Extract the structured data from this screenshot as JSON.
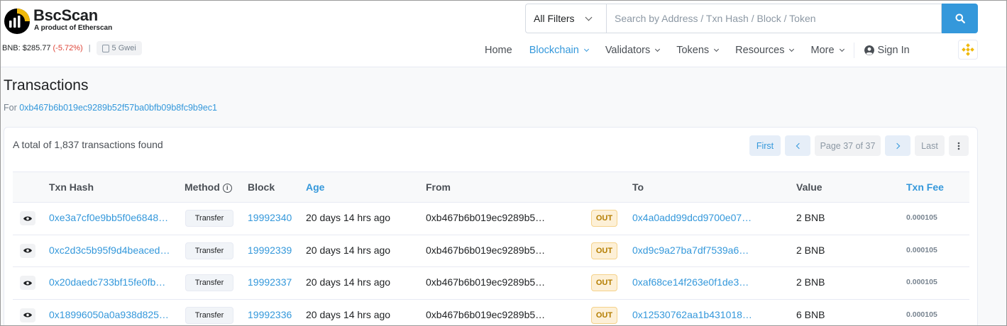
{
  "brand": {
    "name": "BscScan",
    "tagline": "A product of Etherscan"
  },
  "price": {
    "label": "BNB: $285.77",
    "change": "(-5.72%)",
    "separator": "|",
    "gas": "5 Gwei"
  },
  "search": {
    "filter_label": "All Filters",
    "placeholder": "Search by Address / Txn Hash / Block / Token"
  },
  "nav": {
    "items": [
      {
        "label": "Home"
      },
      {
        "label": "Blockchain"
      },
      {
        "label": "Validators"
      },
      {
        "label": "Tokens"
      },
      {
        "label": "Resources"
      },
      {
        "label": "More"
      }
    ],
    "signin": "Sign In"
  },
  "page": {
    "title": "Transactions",
    "for_prefix": "For",
    "address": "0xb467b6b019ec9289b52f57ba0bfb09b8fc9b9ec1"
  },
  "summary": {
    "total_text": "A total of 1,837 transactions found"
  },
  "pager": {
    "first": "First",
    "page_text": "Page 37 of 37",
    "last": "Last"
  },
  "table": {
    "headers": {
      "txn_hash": "Txn Hash",
      "method": "Method",
      "block": "Block",
      "age": "Age",
      "from": "From",
      "to": "To",
      "value": "Value",
      "txn_fee": "Txn Fee"
    },
    "rows": [
      {
        "hash": "0xe3a7cf0e9bb5f0e6848…",
        "method": "Transfer",
        "block": "19992340",
        "age": "20 days 14 hrs ago",
        "from": "0xb467b6b019ec9289b5…",
        "direction": "OUT",
        "to": "0x4a0add99dcd9700e07…",
        "value": "2 BNB",
        "fee": "0.000105"
      },
      {
        "hash": "0xc2d3c5b95f9d4beaced…",
        "method": "Transfer",
        "block": "19992339",
        "age": "20 days 14 hrs ago",
        "from": "0xb467b6b019ec9289b5…",
        "direction": "OUT",
        "to": "0xd9c9a27ba7df7539a6…",
        "value": "2 BNB",
        "fee": "0.000105"
      },
      {
        "hash": "0x20daedc733bf15fe0fb…",
        "method": "Transfer",
        "block": "19992337",
        "age": "20 days 14 hrs ago",
        "from": "0xb467b6b019ec9289b5…",
        "direction": "OUT",
        "to": "0xaf68ce14f263e0f1de3…",
        "value": "2 BNB",
        "fee": "0.000105"
      },
      {
        "hash": "0x18996050a0a938d825…",
        "method": "Transfer",
        "block": "19992336",
        "age": "20 days 14 hrs ago",
        "from": "0xb467b6b019ec9289b5…",
        "direction": "OUT",
        "to": "0x12530762aa1b431018…",
        "value": "6 BNB",
        "fee": "0.000105"
      }
    ]
  },
  "colors": {
    "accent": "#3498db",
    "negative": "#de4437",
    "out_badge": "#fdf0d7",
    "bnb_gold": "#f0b90b"
  }
}
